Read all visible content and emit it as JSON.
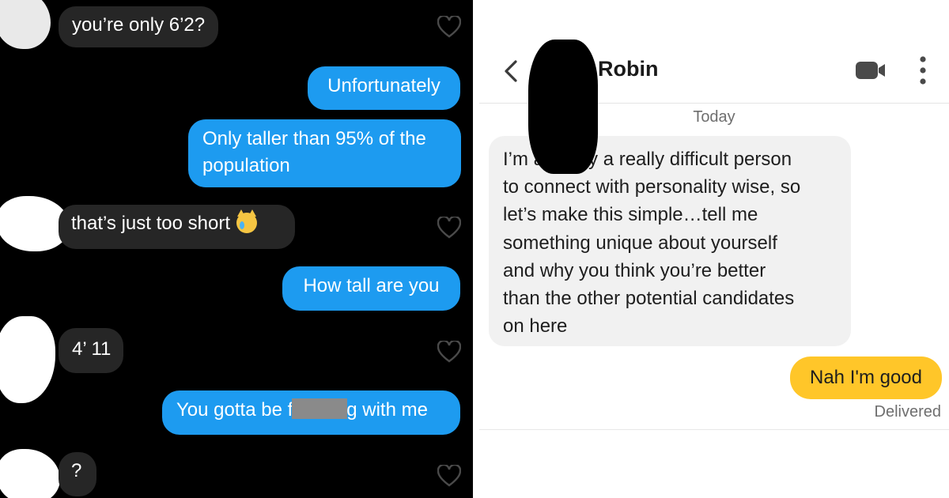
{
  "left_chat": {
    "messages": [
      {
        "sender": "them",
        "text": "you’re only 6’2?"
      },
      {
        "sender": "me",
        "text": "Unfortunately"
      },
      {
        "sender": "me",
        "text": "Only taller than 95% of the population"
      },
      {
        "sender": "them",
        "text": "that’s just too short"
      },
      {
        "sender": "me",
        "text": "How tall are you"
      },
      {
        "sender": "them",
        "text": "4’ 11"
      },
      {
        "sender": "me",
        "text_before": "You gotta be f",
        "text_after": "g with me"
      },
      {
        "sender": "them",
        "text": "?"
      }
    ],
    "emoji": "crying-cat-emoji",
    "colors": {
      "background": "#000000",
      "incoming": "#262626",
      "outgoing": "#1d9bf0"
    }
  },
  "right_chat": {
    "header": {
      "contact_name": "Robin"
    },
    "date_label": "Today",
    "messages": [
      {
        "sender": "them",
        "lines": [
          "I’m actually a really difficult person",
          "to connect with personality wise, so",
          "let’s make this simple…tell me",
          "something unique about yourself",
          "and why you think you’re better",
          "than the other potential candidates",
          "on here"
        ]
      },
      {
        "sender": "me",
        "text": "Nah I'm good"
      }
    ],
    "status": "Delivered",
    "colors": {
      "incoming": "#f1f1f1",
      "outgoing": "#ffc629"
    }
  }
}
